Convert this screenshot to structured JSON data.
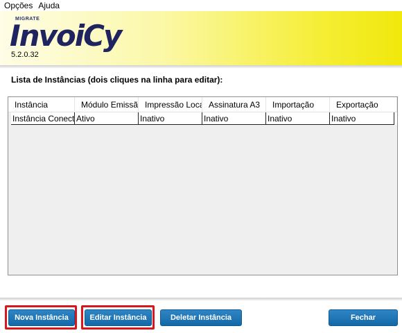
{
  "menu": {
    "items": [
      "Opções",
      "Ajuda"
    ]
  },
  "banner": {
    "brand_small": "MIGRATE",
    "logo": "InvoiCy",
    "version": "5.2.0.32"
  },
  "caption": "Lista de Instâncias (dois cliques na linha para editar):",
  "table": {
    "columns": [
      "Instância",
      "Módulo Emissão",
      "Impressão Local",
      "Assinatura A3",
      "Importação",
      "Exportação"
    ],
    "rows": [
      [
        "Instância Conectada",
        "Ativo",
        "Inativo",
        "Inativo",
        "Inativo",
        "Inativo"
      ]
    ]
  },
  "buttons": {
    "new": "Nova Instância",
    "edit": "Editar Instância",
    "delete": "Deletar Instância",
    "close": "Fechar"
  },
  "colors": {
    "button_blue": "#1a74b5",
    "highlight_red": "#d8161e",
    "banner_yellow": "#f1e80c",
    "logo_navy": "#1f2460"
  }
}
